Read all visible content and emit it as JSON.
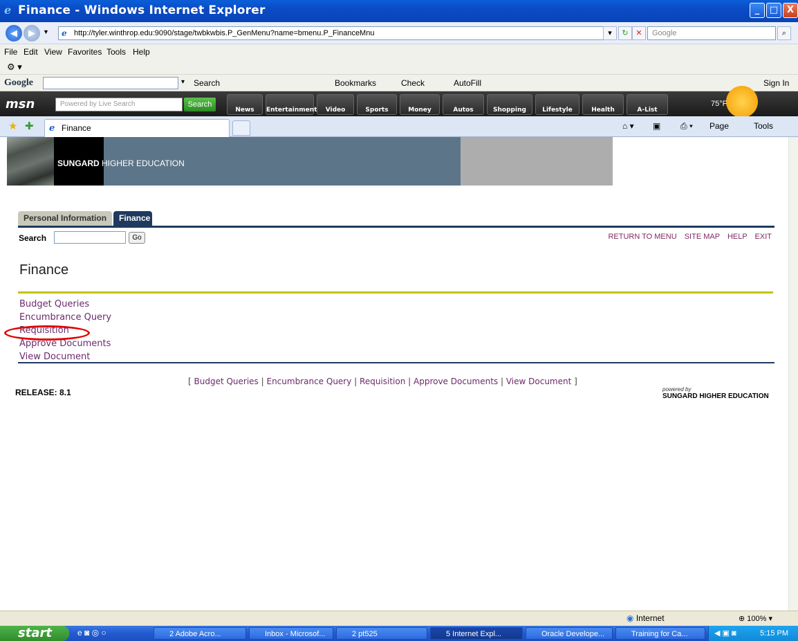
{
  "window": {
    "title": "Finance - Windows Internet Explorer",
    "minimize": "_",
    "maximize": "□",
    "close": "X"
  },
  "addressbar": {
    "url": "http://tyler.winthrop.edu:9090/stage/twbkwbis.P_GenMenu?name=bmenu.P_FinanceMnu",
    "search_placeholder": "Google"
  },
  "menubar": [
    "File",
    "Edit",
    "View",
    "Favorites",
    "Tools",
    "Help"
  ],
  "googlebar": {
    "logo": "Google",
    "items": [
      "Search",
      "Bookmarks",
      "Check",
      "AutoFill",
      "Sign In"
    ]
  },
  "msnbar": {
    "logo": "msn",
    "search_placeholder": "Powered by Live Search",
    "search_button": "Search",
    "buttons": [
      "News",
      "Entertainment",
      "Video",
      "Sports",
      "Money",
      "Autos",
      "Shopping",
      "Lifestyle",
      "Health",
      "A-List"
    ],
    "weather": "75°F"
  },
  "browser_tab": {
    "label": "Finance",
    "tools": [
      "Page",
      "Tools"
    ]
  },
  "banner": {
    "brand_bold": "SUNGARD",
    "brand_rest": " HIGHER EDUCATION"
  },
  "page_tabs": [
    "Personal Information",
    "Finance"
  ],
  "search": {
    "label": "Search",
    "go": "Go"
  },
  "toplinks": [
    "RETURN TO MENU",
    "SITE MAP",
    "HELP",
    "EXIT"
  ],
  "page_title": "Finance",
  "menu_links": [
    "Budget Queries",
    "Encumbrance Query",
    "Requisition",
    "Approve Documents",
    "View Document"
  ],
  "footer": {
    "open": "[ ",
    "close": " ]",
    "separator": " | ",
    "release": "RELEASE: 8.1",
    "powered_small": "powered by",
    "powered_big": "SUNGARD HIGHER EDUCATION"
  },
  "statusbar": {
    "zone": "Internet",
    "zoom": "100%"
  },
  "taskbar": {
    "start": "start",
    "tasks": [
      "2 Adobe Acro...",
      "Inbox - Microsof...",
      "2 pt525",
      "5 Internet Expl...",
      "Oracle Develope...",
      "Training for Ca..."
    ],
    "clock": "5:15 PM"
  }
}
